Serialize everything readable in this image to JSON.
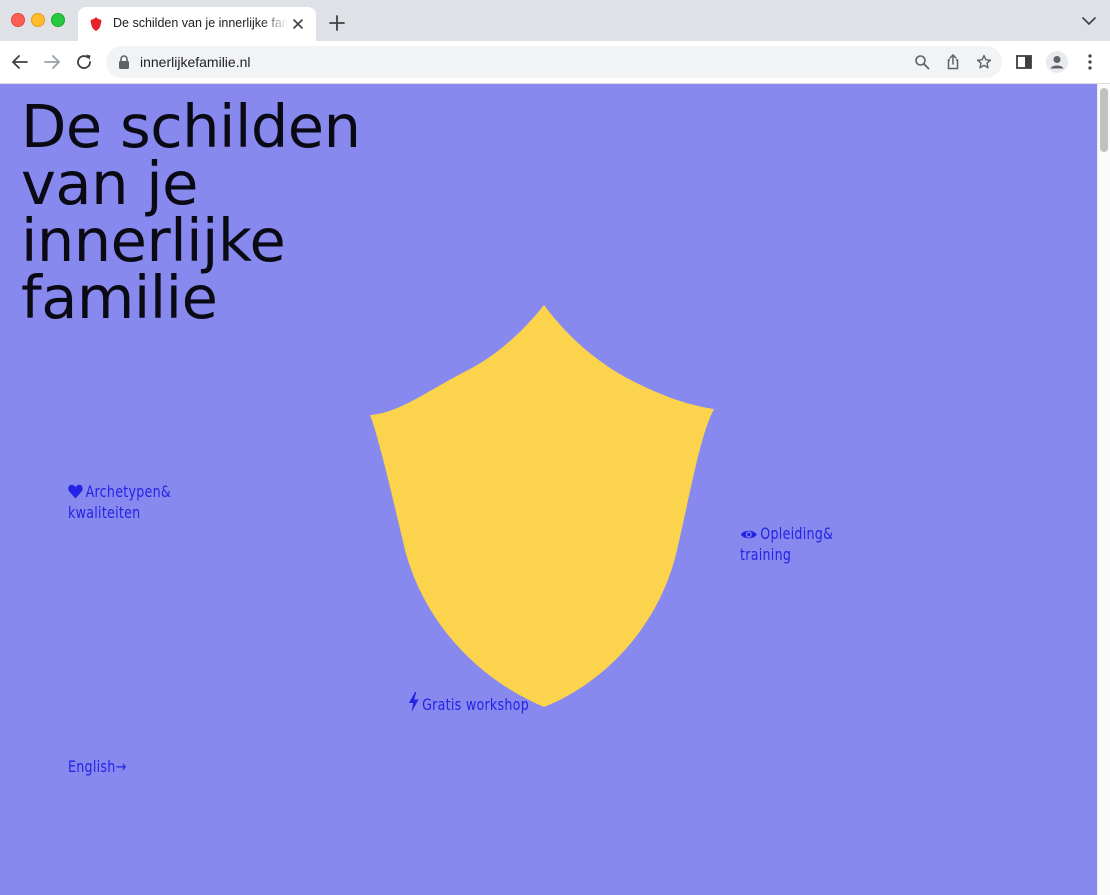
{
  "browser": {
    "tab": {
      "title": "De schilden van je innerlijke familie"
    },
    "address_bar": {
      "url": "innerlijkefamilie.nl"
    }
  },
  "page": {
    "background_color": "#8789ee",
    "headline_lines": [
      "De schilden",
      "van je",
      "innerlijke",
      "familie"
    ],
    "shield_color": "#fcd34d",
    "nav_links": {
      "archetypen": {
        "icon": "heart-icon",
        "line1": "Archetypen&",
        "line2": "kwaliteiten"
      },
      "opleiding": {
        "icon": "eye-icon",
        "line1": "Opleiding&",
        "line2": "training"
      },
      "workshop": {
        "icon": "lightning-icon",
        "label": "Gratis workshop"
      },
      "english": {
        "label": "English",
        "arrow": "→"
      }
    },
    "link_color": "#2323e6"
  }
}
